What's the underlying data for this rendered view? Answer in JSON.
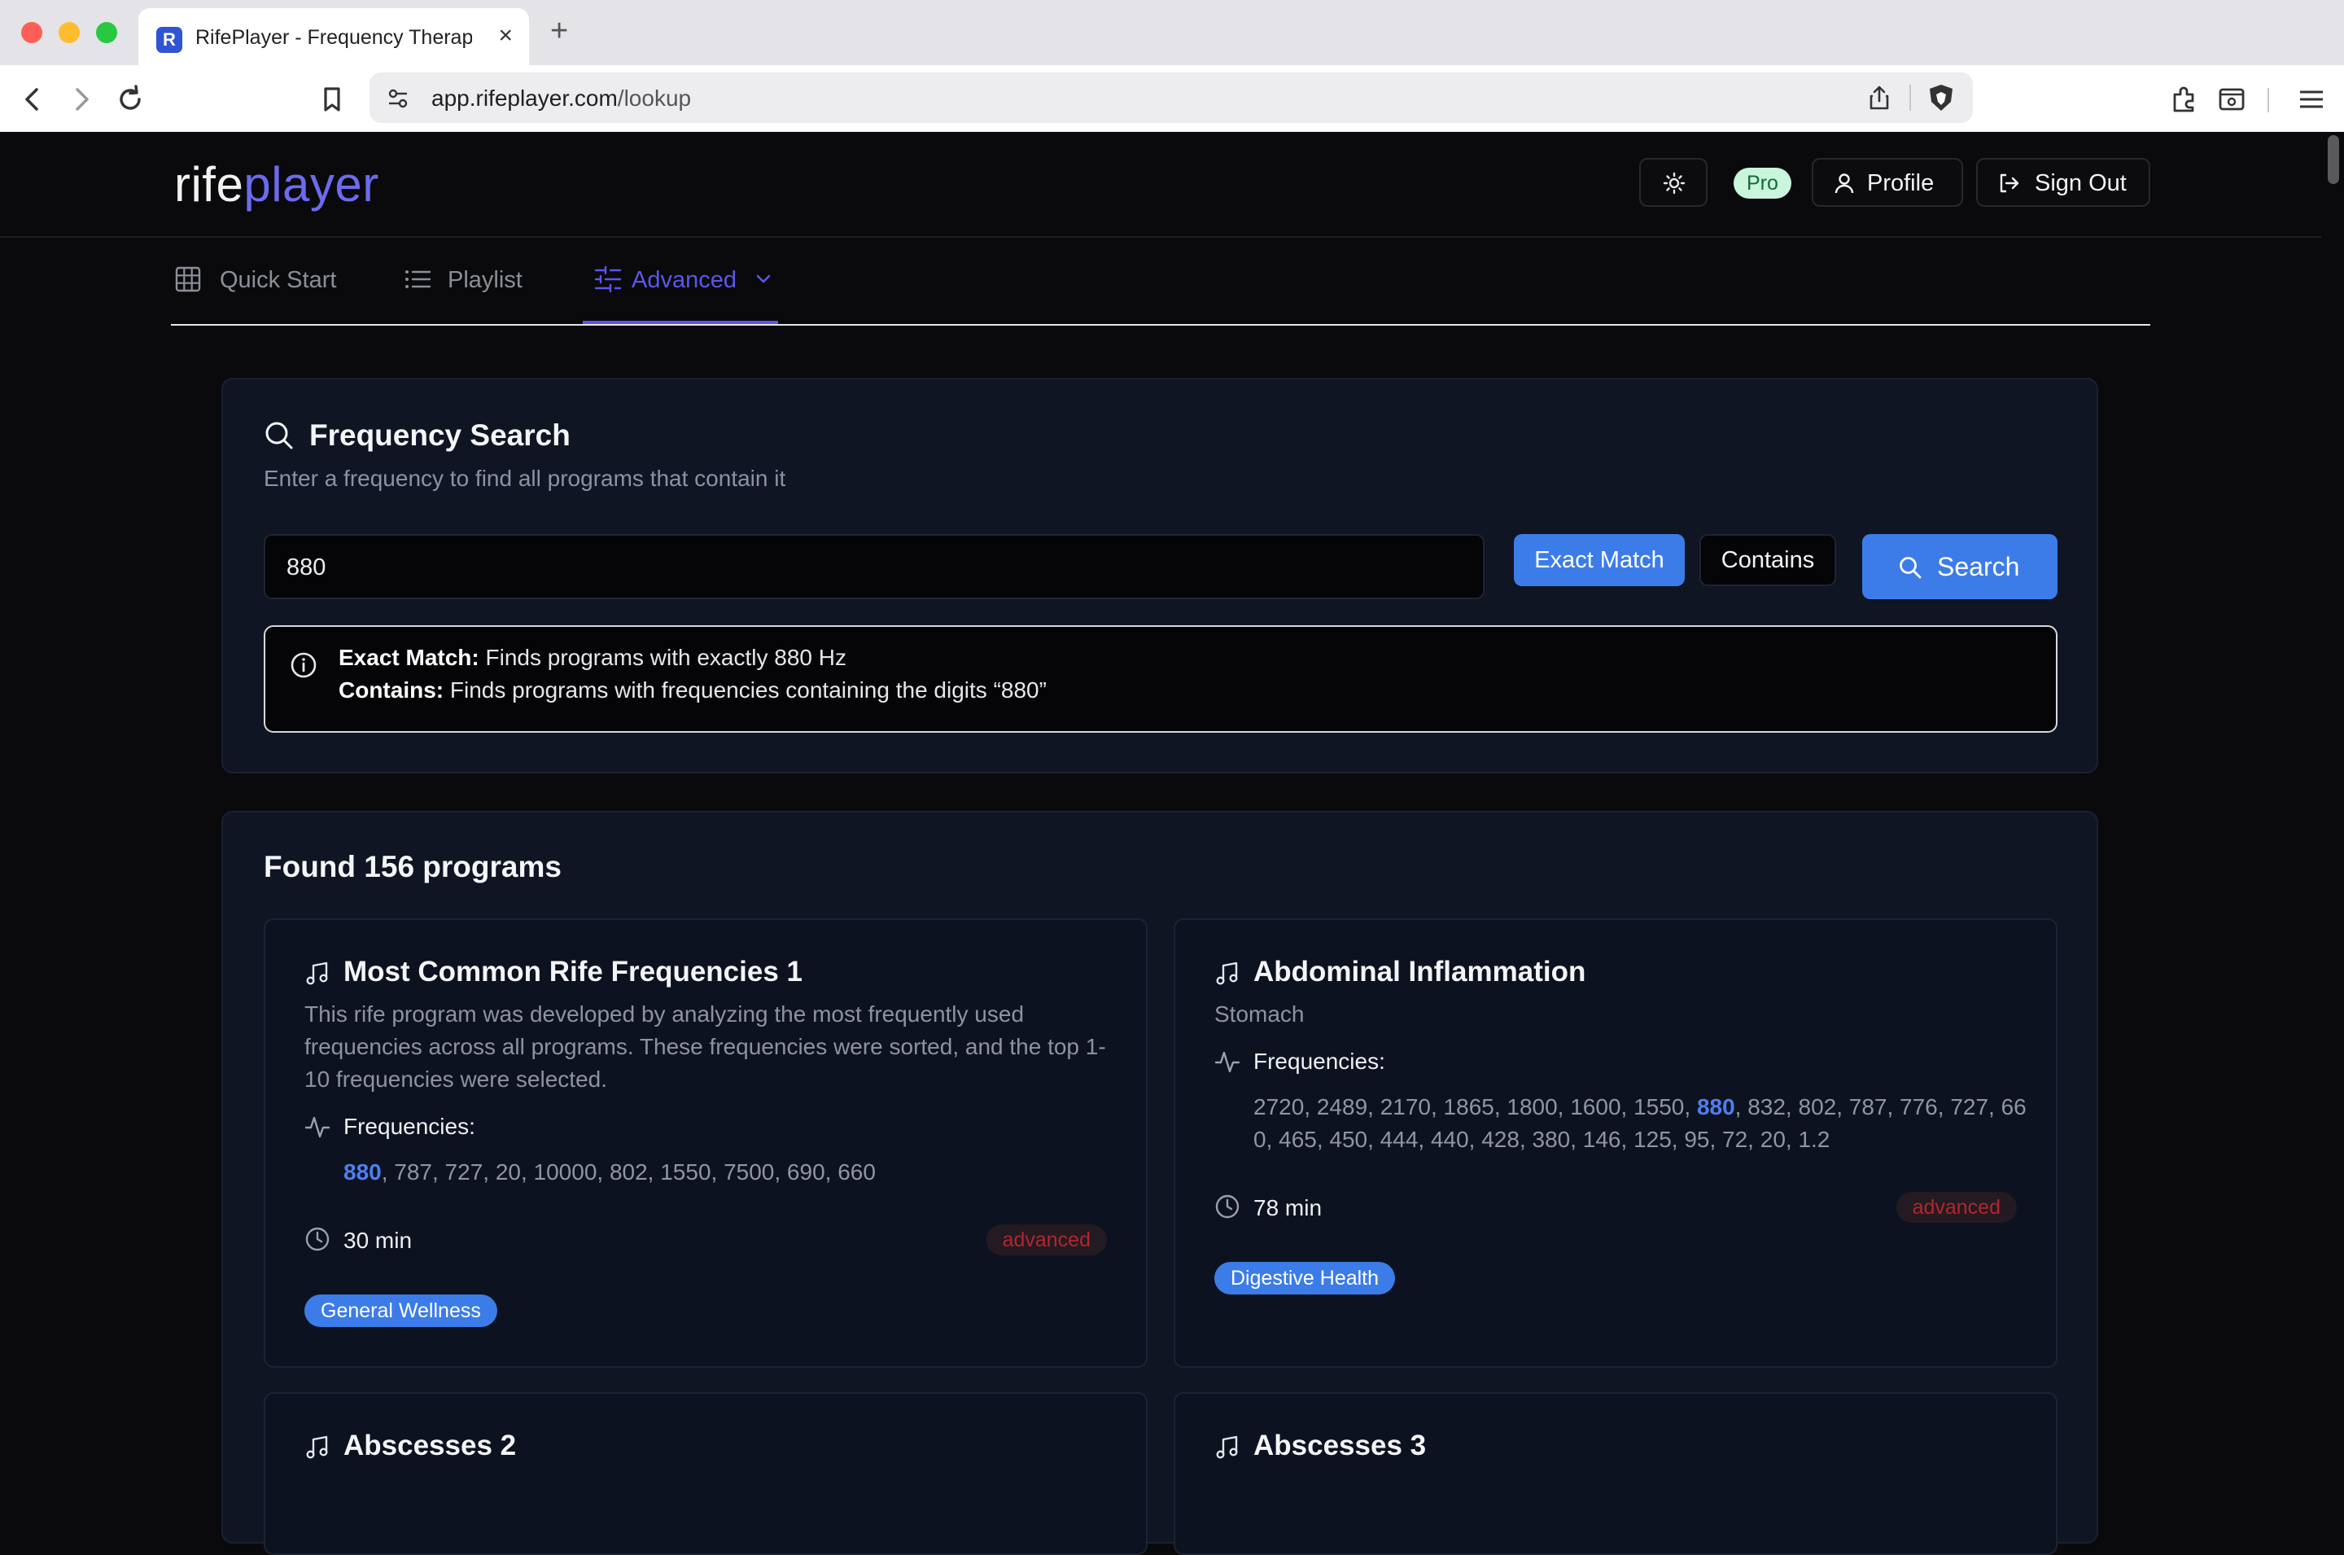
{
  "browser": {
    "tab_title": "RifePlayer - Frequency Therapy",
    "tab_favicon": "R",
    "tab_close": "×",
    "new_tab": "+",
    "url_domain": "app.rifeplayer.com",
    "url_path": "/lookup"
  },
  "header": {
    "logo_a": "rife",
    "logo_b": "player",
    "badge": "Pro",
    "profile_label": "Profile",
    "signout_label": "Sign Out"
  },
  "nav": {
    "quick_start": "Quick Start",
    "playlist": "Playlist",
    "advanced": "Advanced"
  },
  "search": {
    "title": "Frequency Search",
    "subtitle": "Enter a frequency to find all programs that contain it",
    "input_value": "880",
    "exact_label": "Exact Match",
    "contains_label": "Contains",
    "search_button": "Search",
    "info_exact_title": "Exact Match:",
    "info_exact_text": " Finds programs with exactly 880 Hz",
    "info_contains_title": "Contains:",
    "info_contains_text": " Finds programs with frequencies containing the digits “880”"
  },
  "results": {
    "title": "Found 156 programs",
    "programs": [
      {
        "title": "Most Common Rife Frequencies 1",
        "description": "This rife program was developed by analyzing the most frequently used frequencies across all programs. These frequencies were sorted, and the top 1-10 frequencies were selected.",
        "freq_label": "Frequencies:",
        "freq_highlight": "880",
        "freq_before": "",
        "freq_after": ", 787, 727, 20, 10000, 802, 1550, 7500, 690, 660",
        "duration": "30 min",
        "level": "advanced",
        "tag": "General Wellness"
      },
      {
        "title": "Abdominal Inflammation",
        "description": "Stomach",
        "freq_label": "Frequencies:",
        "freq_before": "2720, 2489, 2170, 1865, 1800, 1600, 1550, ",
        "freq_highlight": "880",
        "freq_after": ", 832, 802, 787, 776, 727, 660, 465, 450, 444, 440, 428, 380, 146, 125, 95, 72, 20, 1.2",
        "duration": "78 min",
        "level": "advanced",
        "tag": "Digestive Health"
      },
      {
        "title": "Abscesses 2"
      },
      {
        "title": "Abscesses 3"
      }
    ]
  },
  "colors": {
    "accent": "#5b56ee",
    "button_blue": "#3c7ce8",
    "panel_bg": "#0f1523",
    "page_bg": "#0a0a0c",
    "level_text": "#b3262d"
  },
  "icons": {
    "theme": "sun-icon",
    "profile": "user-icon",
    "signout": "sign-out-icon",
    "quick_start": "grid-icon",
    "playlist": "list-icon",
    "advanced": "sliders-icon",
    "search": "search-icon",
    "info": "info-icon",
    "program": "music-note-icon",
    "frequencies": "activity-icon",
    "duration": "clock-icon"
  }
}
